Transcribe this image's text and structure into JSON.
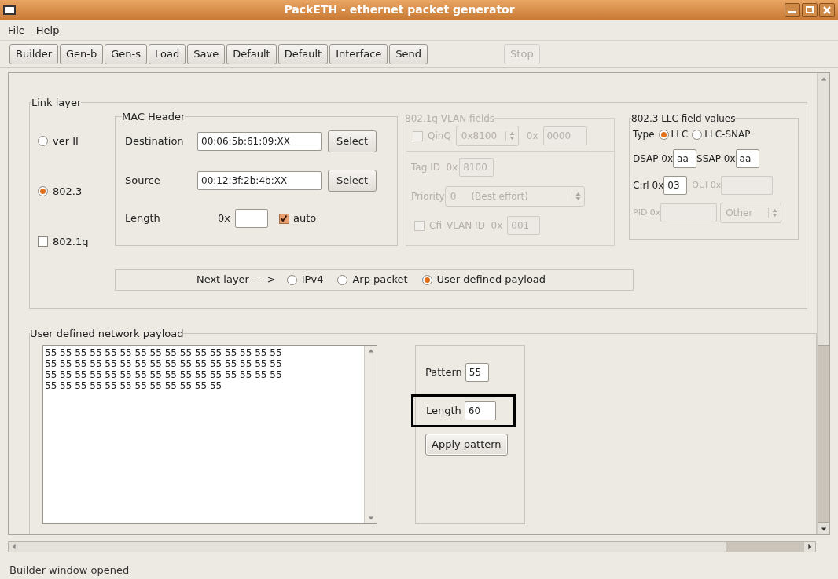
{
  "window": {
    "title": "PackETH - ethernet packet generator"
  },
  "menu": [
    "File",
    "Help"
  ],
  "toolbar": [
    {
      "label": "Builder",
      "disabled": false
    },
    {
      "label": "Gen-b",
      "disabled": false
    },
    {
      "label": "Gen-s",
      "disabled": false
    },
    {
      "label": "Load",
      "disabled": false
    },
    {
      "label": "Save",
      "disabled": false
    },
    {
      "label": "Default",
      "disabled": false
    },
    {
      "label": "Default",
      "disabled": false
    },
    {
      "label": "Interface",
      "disabled": false
    },
    {
      "label": "Send",
      "disabled": false
    },
    {
      "label": "Stop",
      "disabled": true
    }
  ],
  "link_layer": {
    "title": "Link layer",
    "options": [
      {
        "kind": "radio",
        "label": "ver II",
        "checked": false
      },
      {
        "kind": "radio",
        "label": "802.3",
        "checked": true
      },
      {
        "kind": "checkbox",
        "label": "802.1q",
        "checked": false
      }
    ],
    "mac_header": {
      "title": "MAC Header",
      "destination": {
        "label": "Destination",
        "value": "00:06:5b:61:09:XX",
        "button": "Select"
      },
      "source": {
        "label": "Source",
        "value": "00:12:3f:2b:4b:XX",
        "button": "Select"
      },
      "length": {
        "label": "Length",
        "prefix": "0x",
        "auto": {
          "label": "auto",
          "checked": true
        }
      }
    },
    "vlan": {
      "title": "802.1q VLAN fields",
      "disabled": true,
      "qinq": {
        "label": "QinQ",
        "checked": false,
        "select": "0x8100",
        "prefix": "0x",
        "value": "0000"
      },
      "tag_id": {
        "label": "Tag ID  0x",
        "value": "8100"
      },
      "priority": {
        "label": "Priority",
        "value": "0     (Best effort)"
      },
      "cfi": {
        "label": "Cfi",
        "checked": false
      },
      "vlan_id": {
        "label": "VLAN ID  0x",
        "value": "001"
      }
    },
    "llc": {
      "title": "802.3 LLC field values",
      "type_label": "Type",
      "types": [
        {
          "label": "LLC",
          "selected": true
        },
        {
          "label": "LLC-SNAP",
          "selected": false
        }
      ],
      "dsap": {
        "label": "DSAP 0x",
        "value": "aa"
      },
      "ssap": {
        "label": "SSAP 0x",
        "value": "aa"
      },
      "ctrl": {
        "label": "C:rl 0x",
        "value": "03"
      },
      "oui": {
        "label": "OUI 0x",
        "disabled": true
      },
      "pid": {
        "label": "PID 0x",
        "disabled": true,
        "select": "Other"
      }
    },
    "next_layer": {
      "label": "Next layer ---->",
      "options": [
        {
          "label": "IPv4",
          "selected": false
        },
        {
          "label": "Arp packet",
          "selected": false
        },
        {
          "label": "User defined payload",
          "selected": true
        }
      ]
    }
  },
  "payload": {
    "title": "User defined network payload",
    "lines": [
      "55 55 55 55 55 55 55 55 55 55 55 55 55 55 55 55",
      "55 55 55 55 55 55 55 55 55 55 55 55 55 55 55 55",
      "55 55 55 55 55 55 55 55 55 55 55 55 55 55 55 55",
      "55 55 55 55 55 55 55 55 55 55 55 55"
    ],
    "pattern": {
      "label": "Pattern",
      "value": "55"
    },
    "length": {
      "label": "Length",
      "value": "60",
      "highlighted": true
    },
    "apply": "Apply pattern"
  },
  "status_bar": "Builder window opened"
}
